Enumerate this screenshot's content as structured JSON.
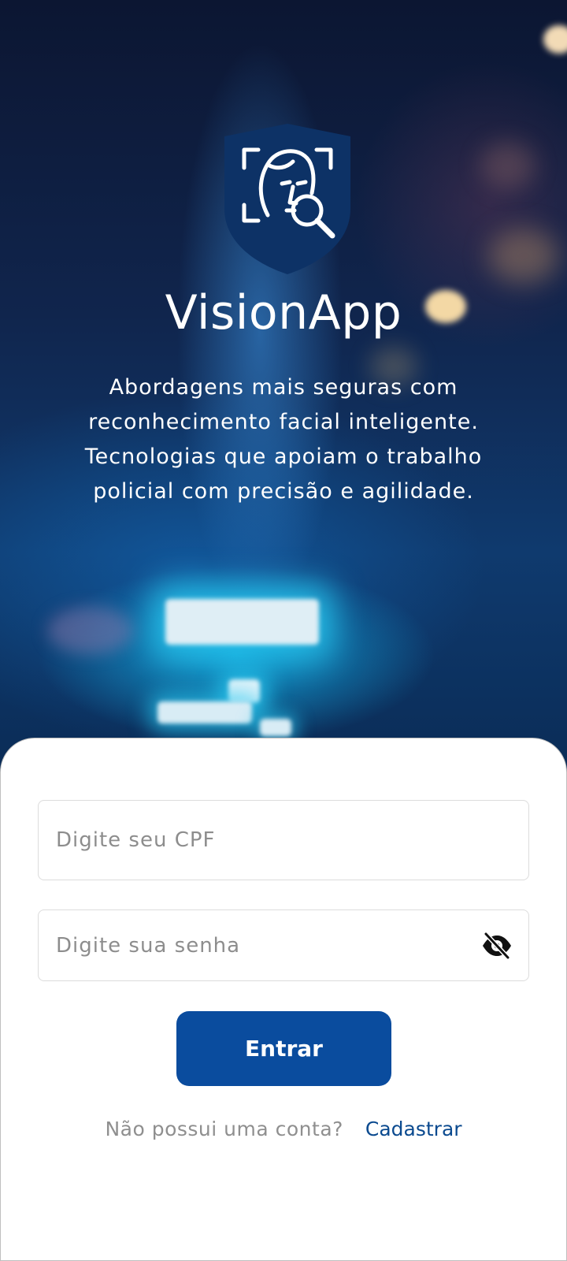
{
  "app": {
    "name": "VisionApp",
    "tagline_lines": [
      "Abordagens mais seguras com",
      "reconhecimento facial inteligente.",
      "Tecnologias que apoiam o trabalho",
      "policial com precisão e agilidade."
    ]
  },
  "icons": {
    "logo": "shield-face-scan-icon",
    "password_toggle": "eye-off-icon"
  },
  "login": {
    "cpf_placeholder": "Digite seu CPF",
    "password_placeholder": "Digite sua senha",
    "submit_label": "Entrar"
  },
  "signup": {
    "question": "Não possui uma conta?",
    "link_label": "Cadastrar"
  },
  "colors": {
    "primary": "#0a4c9e",
    "link": "#0b4a8f",
    "shield": "#0d3266"
  }
}
